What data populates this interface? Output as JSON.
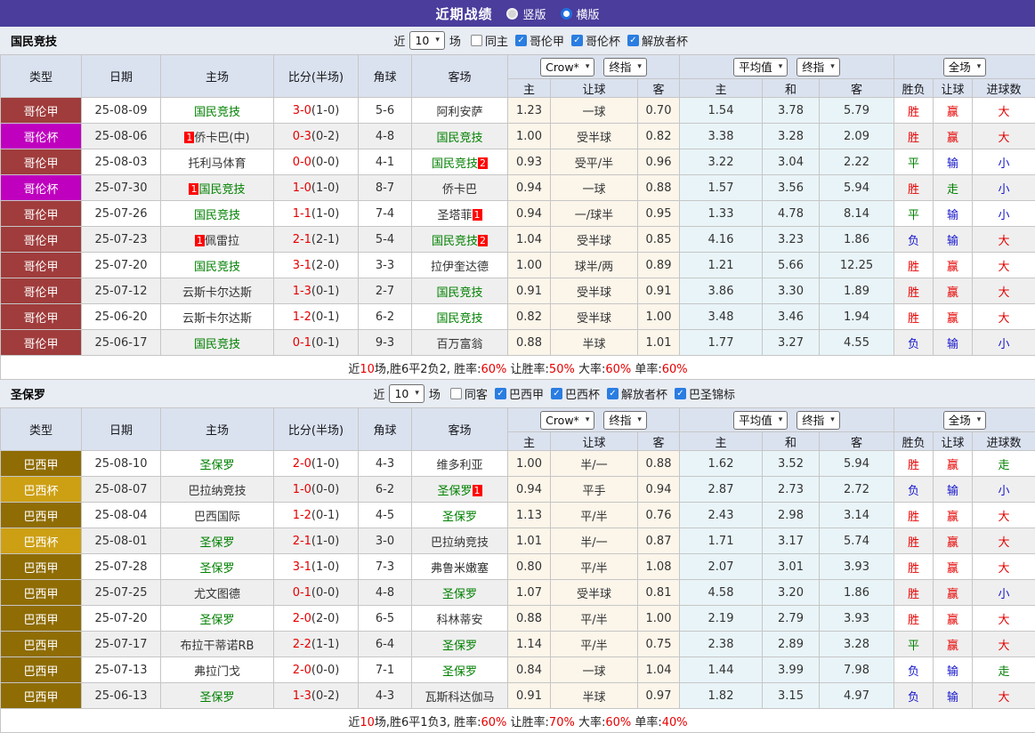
{
  "topbar": {
    "title": "近期战绩",
    "options": [
      {
        "label": "竖版",
        "selected": true
      },
      {
        "label": "横版",
        "selected": false
      }
    ]
  },
  "colors": {
    "leagues": {
      "哥伦甲": "#A03C3C",
      "哥伦杯": "#BF00BF",
      "巴西甲": "#8F6D04",
      "巴西杯": "#CDA014"
    }
  },
  "table_header": {
    "left": [
      "类型",
      "日期",
      "主场",
      "比分(半场)",
      "角球",
      "客场"
    ],
    "sub": [
      "主",
      "让球",
      "客",
      "主",
      "和",
      "客",
      "胜负",
      "让球",
      "进球数"
    ]
  },
  "sections": [
    {
      "team": "国民竞技",
      "filter": {
        "near": "近",
        "count": "10",
        "games": "场",
        "same": {
          "label": "同主",
          "checked": false
        },
        "leagues": [
          {
            "label": "哥伦甲",
            "checked": true
          },
          {
            "label": "哥伦杯",
            "checked": true
          },
          {
            "label": "解放者杯",
            "checked": true
          }
        ]
      },
      "selects": {
        "odds1": "Crow*",
        "odds2": "终指",
        "avg1": "平均值",
        "avg2": "终指",
        "scope": "全场"
      },
      "rows": [
        {
          "league": "哥伦甲",
          "date": "25-08-09",
          "home": {
            "name": "国民竞技",
            "focal": true
          },
          "score": "3-0",
          "half": "(1-0)",
          "corner": "5-6",
          "away": {
            "name": "阿利安萨",
            "focal": false
          },
          "odds": [
            "1.23",
            "一球",
            "0.70"
          ],
          "avg": [
            "1.54",
            "3.78",
            "5.79"
          ],
          "res": [
            [
              "胜",
              "red"
            ],
            [
              "赢",
              "red"
            ],
            [
              "大",
              "red"
            ]
          ]
        },
        {
          "league": "哥伦杯",
          "date": "25-08-06",
          "home": {
            "name": "侨卡巴(中)",
            "focal": false,
            "badge_before": "1"
          },
          "score": "0-3",
          "half": "(0-2)",
          "corner": "4-8",
          "away": {
            "name": "国民竞技",
            "focal": true
          },
          "odds": [
            "1.00",
            "受半球",
            "0.82"
          ],
          "avg": [
            "3.38",
            "3.28",
            "2.09"
          ],
          "res": [
            [
              "胜",
              "red"
            ],
            [
              "赢",
              "red"
            ],
            [
              "大",
              "red"
            ]
          ]
        },
        {
          "league": "哥伦甲",
          "date": "25-08-03",
          "home": {
            "name": "托利马体育",
            "focal": false
          },
          "score": "0-0",
          "half": "(0-0)",
          "corner": "4-1",
          "away": {
            "name": "国民竞技",
            "focal": true,
            "badge_after": "2"
          },
          "odds": [
            "0.93",
            "受平/半",
            "0.96"
          ],
          "avg": [
            "3.22",
            "3.04",
            "2.22"
          ],
          "res": [
            [
              "平",
              "green"
            ],
            [
              "输",
              "blue"
            ],
            [
              "小",
              "blue"
            ]
          ]
        },
        {
          "league": "哥伦杯",
          "date": "25-07-30",
          "home": {
            "name": "国民竞技",
            "focal": true,
            "badge_before": "1"
          },
          "score": "1-0",
          "half": "(1-0)",
          "corner": "8-7",
          "away": {
            "name": "侨卡巴",
            "focal": false
          },
          "odds": [
            "0.94",
            "一球",
            "0.88"
          ],
          "avg": [
            "1.57",
            "3.56",
            "5.94"
          ],
          "res": [
            [
              "胜",
              "red"
            ],
            [
              "走",
              "green"
            ],
            [
              "小",
              "blue"
            ]
          ]
        },
        {
          "league": "哥伦甲",
          "date": "25-07-26",
          "home": {
            "name": "国民竞技",
            "focal": true
          },
          "score": "1-1",
          "half": "(1-0)",
          "corner": "7-4",
          "away": {
            "name": "圣塔菲",
            "focal": false,
            "badge_after": "1"
          },
          "odds": [
            "0.94",
            "一/球半",
            "0.95"
          ],
          "avg": [
            "1.33",
            "4.78",
            "8.14"
          ],
          "res": [
            [
              "平",
              "green"
            ],
            [
              "输",
              "blue"
            ],
            [
              "小",
              "blue"
            ]
          ]
        },
        {
          "league": "哥伦甲",
          "date": "25-07-23",
          "home": {
            "name": "佩雷拉",
            "focal": false,
            "badge_before": "1"
          },
          "score": "2-1",
          "half": "(2-1)",
          "corner": "5-4",
          "away": {
            "name": "国民竞技",
            "focal": true,
            "badge_after": "2"
          },
          "odds": [
            "1.04",
            "受半球",
            "0.85"
          ],
          "avg": [
            "4.16",
            "3.23",
            "1.86"
          ],
          "res": [
            [
              "负",
              "blue"
            ],
            [
              "输",
              "blue"
            ],
            [
              "大",
              "red"
            ]
          ]
        },
        {
          "league": "哥伦甲",
          "date": "25-07-20",
          "home": {
            "name": "国民竞技",
            "focal": true
          },
          "score": "3-1",
          "half": "(2-0)",
          "corner": "3-3",
          "away": {
            "name": "拉伊奎达德",
            "focal": false
          },
          "odds": [
            "1.00",
            "球半/两",
            "0.89"
          ],
          "avg": [
            "1.21",
            "5.66",
            "12.25"
          ],
          "res": [
            [
              "胜",
              "red"
            ],
            [
              "赢",
              "red"
            ],
            [
              "大",
              "red"
            ]
          ]
        },
        {
          "league": "哥伦甲",
          "date": "25-07-12",
          "home": {
            "name": "云斯卡尔达斯",
            "focal": false
          },
          "score": "1-3",
          "half": "(0-1)",
          "corner": "2-7",
          "away": {
            "name": "国民竞技",
            "focal": true
          },
          "odds": [
            "0.91",
            "受半球",
            "0.91"
          ],
          "avg": [
            "3.86",
            "3.30",
            "1.89"
          ],
          "res": [
            [
              "胜",
              "red"
            ],
            [
              "赢",
              "red"
            ],
            [
              "大",
              "red"
            ]
          ]
        },
        {
          "league": "哥伦甲",
          "date": "25-06-20",
          "home": {
            "name": "云斯卡尔达斯",
            "focal": false
          },
          "score": "1-2",
          "half": "(0-1)",
          "corner": "6-2",
          "away": {
            "name": "国民竞技",
            "focal": true
          },
          "odds": [
            "0.82",
            "受半球",
            "1.00"
          ],
          "avg": [
            "3.48",
            "3.46",
            "1.94"
          ],
          "res": [
            [
              "胜",
              "red"
            ],
            [
              "赢",
              "red"
            ],
            [
              "大",
              "red"
            ]
          ]
        },
        {
          "league": "哥伦甲",
          "date": "25-06-17",
          "home": {
            "name": "国民竞技",
            "focal": true
          },
          "score": "0-1",
          "half": "(0-1)",
          "corner": "9-3",
          "away": {
            "name": "百万富翁",
            "focal": false
          },
          "odds": [
            "0.88",
            "半球",
            "1.01"
          ],
          "avg": [
            "1.77",
            "3.27",
            "4.55"
          ],
          "res": [
            [
              "负",
              "blue"
            ],
            [
              "输",
              "blue"
            ],
            [
              "小",
              "blue"
            ]
          ]
        }
      ],
      "summary": [
        {
          "t": "近",
          "c": "k"
        },
        {
          "t": "10",
          "c": "red"
        },
        {
          "t": "场,胜6平2负2, 胜率:",
          "c": "k"
        },
        {
          "t": "60%",
          "c": "red"
        },
        {
          "t": " 让胜率:",
          "c": "k"
        },
        {
          "t": "50%",
          "c": "red"
        },
        {
          "t": " 大率:",
          "c": "k"
        },
        {
          "t": "60%",
          "c": "red"
        },
        {
          "t": " 单率:",
          "c": "k"
        },
        {
          "t": "60%",
          "c": "red"
        }
      ]
    },
    {
      "team": "圣保罗",
      "filter": {
        "near": "近",
        "count": "10",
        "games": "场",
        "same": {
          "label": "同客",
          "checked": false
        },
        "leagues": [
          {
            "label": "巴西甲",
            "checked": true
          },
          {
            "label": "巴西杯",
            "checked": true
          },
          {
            "label": "解放者杯",
            "checked": true
          },
          {
            "label": "巴圣锦标",
            "checked": true
          }
        ]
      },
      "selects": {
        "odds1": "Crow*",
        "odds2": "终指",
        "avg1": "平均值",
        "avg2": "终指",
        "scope": "全场"
      },
      "rows": [
        {
          "league": "巴西甲",
          "date": "25-08-10",
          "home": {
            "name": "圣保罗",
            "focal": true
          },
          "score": "2-0",
          "half": "(1-0)",
          "corner": "4-3",
          "away": {
            "name": "维多利亚",
            "focal": false
          },
          "odds": [
            "1.00",
            "半/一",
            "0.88"
          ],
          "avg": [
            "1.62",
            "3.52",
            "5.94"
          ],
          "res": [
            [
              "胜",
              "red"
            ],
            [
              "赢",
              "red"
            ],
            [
              "走",
              "green"
            ]
          ]
        },
        {
          "league": "巴西杯",
          "date": "25-08-07",
          "home": {
            "name": "巴拉纳竞技",
            "focal": false
          },
          "score": "1-0",
          "half": "(0-0)",
          "corner": "6-2",
          "away": {
            "name": "圣保罗",
            "focal": true,
            "badge_after": "1"
          },
          "odds": [
            "0.94",
            "平手",
            "0.94"
          ],
          "avg": [
            "2.87",
            "2.73",
            "2.72"
          ],
          "res": [
            [
              "负",
              "blue"
            ],
            [
              "输",
              "blue"
            ],
            [
              "小",
              "blue"
            ]
          ]
        },
        {
          "league": "巴西甲",
          "date": "25-08-04",
          "home": {
            "name": "巴西国际",
            "focal": false
          },
          "score": "1-2",
          "half": "(0-1)",
          "corner": "4-5",
          "away": {
            "name": "圣保罗",
            "focal": true
          },
          "odds": [
            "1.13",
            "平/半",
            "0.76"
          ],
          "avg": [
            "2.43",
            "2.98",
            "3.14"
          ],
          "res": [
            [
              "胜",
              "red"
            ],
            [
              "赢",
              "red"
            ],
            [
              "大",
              "red"
            ]
          ]
        },
        {
          "league": "巴西杯",
          "date": "25-08-01",
          "home": {
            "name": "圣保罗",
            "focal": true
          },
          "score": "2-1",
          "half": "(1-0)",
          "corner": "3-0",
          "away": {
            "name": "巴拉纳竞技",
            "focal": false
          },
          "odds": [
            "1.01",
            "半/一",
            "0.87"
          ],
          "avg": [
            "1.71",
            "3.17",
            "5.74"
          ],
          "res": [
            [
              "胜",
              "red"
            ],
            [
              "赢",
              "red"
            ],
            [
              "大",
              "red"
            ]
          ]
        },
        {
          "league": "巴西甲",
          "date": "25-07-28",
          "home": {
            "name": "圣保罗",
            "focal": true
          },
          "score": "3-1",
          "half": "(1-0)",
          "corner": "7-3",
          "away": {
            "name": "弗鲁米嫩塞",
            "focal": false
          },
          "odds": [
            "0.80",
            "平/半",
            "1.08"
          ],
          "avg": [
            "2.07",
            "3.01",
            "3.93"
          ],
          "res": [
            [
              "胜",
              "red"
            ],
            [
              "赢",
              "red"
            ],
            [
              "大",
              "red"
            ]
          ]
        },
        {
          "league": "巴西甲",
          "date": "25-07-25",
          "home": {
            "name": "尤文图德",
            "focal": false
          },
          "score": "0-1",
          "half": "(0-0)",
          "corner": "4-8",
          "away": {
            "name": "圣保罗",
            "focal": true
          },
          "odds": [
            "1.07",
            "受半球",
            "0.81"
          ],
          "avg": [
            "4.58",
            "3.20",
            "1.86"
          ],
          "res": [
            [
              "胜",
              "red"
            ],
            [
              "赢",
              "red"
            ],
            [
              "小",
              "blue"
            ]
          ]
        },
        {
          "league": "巴西甲",
          "date": "25-07-20",
          "home": {
            "name": "圣保罗",
            "focal": true
          },
          "score": "2-0",
          "half": "(2-0)",
          "corner": "6-5",
          "away": {
            "name": "科林蒂安",
            "focal": false
          },
          "odds": [
            "0.88",
            "平/半",
            "1.00"
          ],
          "avg": [
            "2.19",
            "2.79",
            "3.93"
          ],
          "res": [
            [
              "胜",
              "red"
            ],
            [
              "赢",
              "red"
            ],
            [
              "大",
              "red"
            ]
          ]
        },
        {
          "league": "巴西甲",
          "date": "25-07-17",
          "home": {
            "name": "布拉干蒂诺RB",
            "focal": false
          },
          "score": "2-2",
          "half": "(1-1)",
          "corner": "6-4",
          "away": {
            "name": "圣保罗",
            "focal": true
          },
          "odds": [
            "1.14",
            "平/半",
            "0.75"
          ],
          "avg": [
            "2.38",
            "2.89",
            "3.28"
          ],
          "res": [
            [
              "平",
              "green"
            ],
            [
              "赢",
              "red"
            ],
            [
              "大",
              "red"
            ]
          ]
        },
        {
          "league": "巴西甲",
          "date": "25-07-13",
          "home": {
            "name": "弗拉门戈",
            "focal": false
          },
          "score": "2-0",
          "half": "(0-0)",
          "corner": "7-1",
          "away": {
            "name": "圣保罗",
            "focal": true
          },
          "odds": [
            "0.84",
            "一球",
            "1.04"
          ],
          "avg": [
            "1.44",
            "3.99",
            "7.98"
          ],
          "res": [
            [
              "负",
              "blue"
            ],
            [
              "输",
              "blue"
            ],
            [
              "走",
              "green"
            ]
          ]
        },
        {
          "league": "巴西甲",
          "date": "25-06-13",
          "home": {
            "name": "圣保罗",
            "focal": true
          },
          "score": "1-3",
          "half": "(0-2)",
          "corner": "4-3",
          "away": {
            "name": "瓦斯科达伽马",
            "focal": false
          },
          "odds": [
            "0.91",
            "半球",
            "0.97"
          ],
          "avg": [
            "1.82",
            "3.15",
            "4.97"
          ],
          "res": [
            [
              "负",
              "blue"
            ],
            [
              "输",
              "blue"
            ],
            [
              "大",
              "red"
            ]
          ]
        }
      ],
      "summary": [
        {
          "t": "近",
          "c": "k"
        },
        {
          "t": "10",
          "c": "red"
        },
        {
          "t": "场,胜6平1负3, 胜率:",
          "c": "k"
        },
        {
          "t": "60%",
          "c": "red"
        },
        {
          "t": " 让胜率:",
          "c": "k"
        },
        {
          "t": "70%",
          "c": "red"
        },
        {
          "t": " 大率:",
          "c": "k"
        },
        {
          "t": "60%",
          "c": "red"
        },
        {
          "t": " 单率:",
          "c": "k"
        },
        {
          "t": "40%",
          "c": "red"
        }
      ]
    }
  ]
}
